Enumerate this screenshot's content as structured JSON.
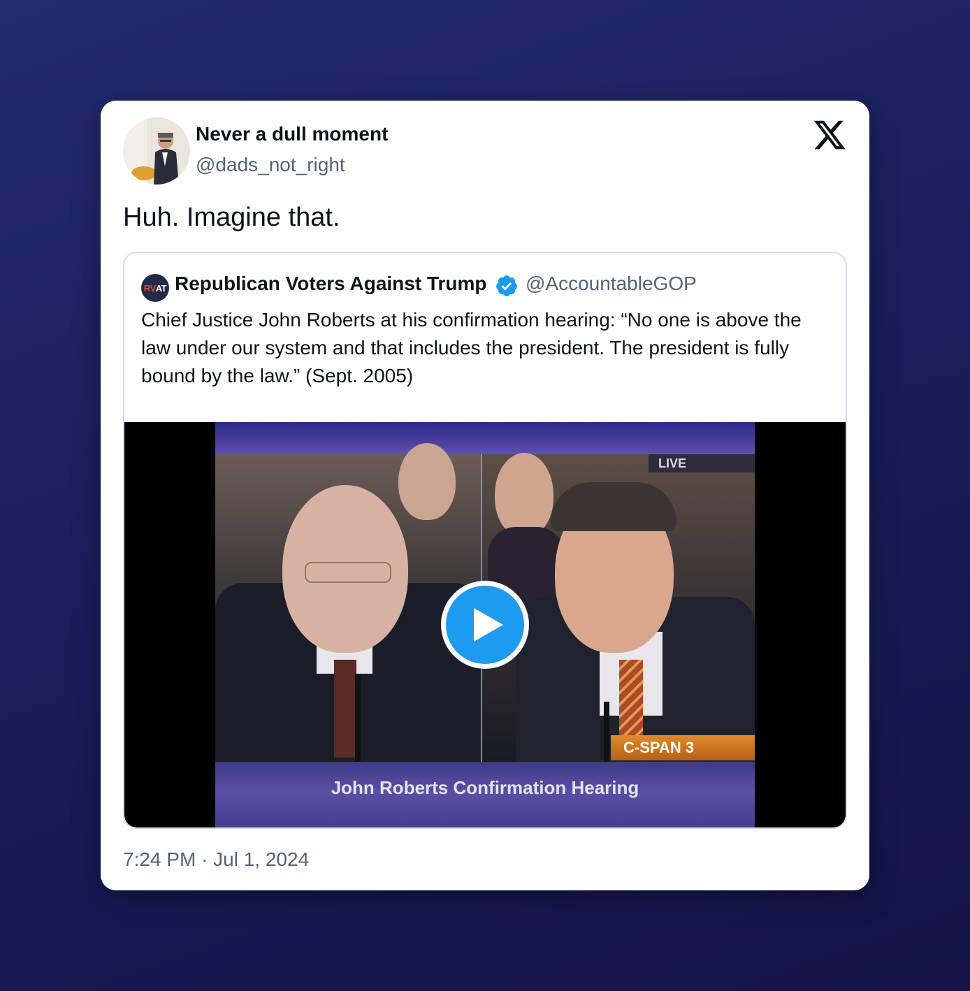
{
  "tweet": {
    "author": {
      "name": "Never a dull moment",
      "handle": "@dads_not_right",
      "avatar_icon": "avatar-photo"
    },
    "text": "Huh. Imagine that.",
    "timestamp": "7:24 PM · Jul 1, 2024",
    "platform_icon": "x-logo-icon"
  },
  "quoted_tweet": {
    "author": {
      "name": "Republican Voters Against Trump",
      "handle": "@AccountableGOP",
      "avatar_text_a": "RV",
      "avatar_text_b": "AT",
      "verified": true
    },
    "text": "Chief Justice John Roberts at his confirmation hearing: “No one is above the law under our system and that includes the president. The president is fully bound by the law.” (Sept. 2005)",
    "video": {
      "live_label": "LIVE",
      "network_label": "C-SPAN 3",
      "caption": "John Roberts Confirmation Hearing",
      "play_icon": "play-icon"
    }
  },
  "colors": {
    "background": "#1a1f5c",
    "card": "#ffffff",
    "primary_text": "#0f1419",
    "secondary_text": "#536471",
    "verified_blue": "#1d9bf0",
    "play_blue": "#1d9bf0",
    "border": "#d6dde3"
  }
}
